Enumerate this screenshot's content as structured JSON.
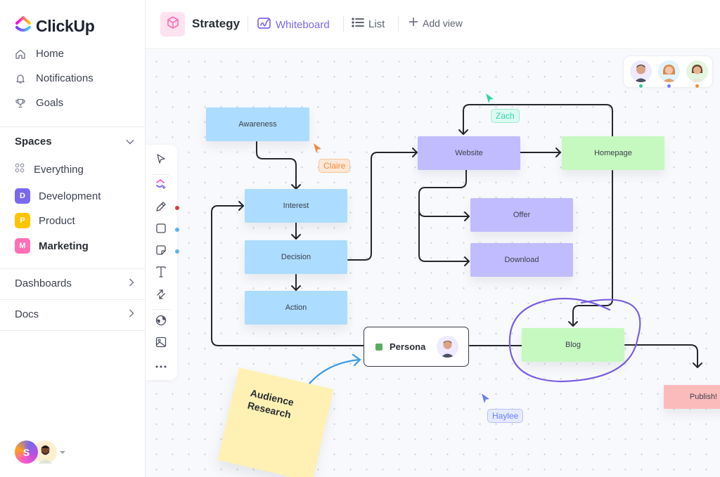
{
  "sidebar": {
    "brand": "ClickUp",
    "nav": [
      {
        "label": "Home",
        "icon": "home-icon"
      },
      {
        "label": "Notifications",
        "icon": "bell-icon"
      },
      {
        "label": "Goals",
        "icon": "trophy-icon"
      }
    ],
    "spaces_label": "Spaces",
    "everything_label": "Everything",
    "spaces": [
      {
        "letter": "D",
        "label": "Development",
        "color": "#7b68ee"
      },
      {
        "letter": "P",
        "label": "Product",
        "color": "#ffc400"
      },
      {
        "letter": "M",
        "label": "Marketing",
        "color": "#ff6fb6",
        "active": true
      }
    ],
    "dashboards_label": "Dashboards",
    "docs_label": "Docs",
    "user_initial": "S"
  },
  "header": {
    "project_title": "Strategy",
    "views": [
      {
        "label": "Whiteboard",
        "active": true
      },
      {
        "label": "List",
        "active": false
      }
    ],
    "add_view_label": "Add view"
  },
  "canvas": {
    "collaborators": [
      {
        "name": "collaborator-1",
        "status_color": "#22d39b",
        "bg": "#efeaff"
      },
      {
        "name": "collaborator-2",
        "status_color": "#6a7cff",
        "bg": "#e2f3fb"
      },
      {
        "name": "collaborator-3",
        "status_color": "#f08a2c",
        "bg": "#e4f5e0"
      }
    ],
    "nodes": {
      "awareness": "Awareness",
      "interest": "Interest",
      "decision": "Decision",
      "action": "Action",
      "website": "Website",
      "homepage": "Homepage",
      "offer": "Offer",
      "download": "Download",
      "blog": "Blog",
      "publish": "Publish!"
    },
    "persona_label": "Persona",
    "sticky_note": "Audience Research",
    "cursors": [
      {
        "name": "Claire",
        "color": "#f08a3c"
      },
      {
        "name": "Zach",
        "color": "#2fd6a3"
      },
      {
        "name": "Haylee",
        "color": "#6a7cff"
      }
    ],
    "colors": {
      "accent": "#7b68ee",
      "node_blue": "#acdcff",
      "node_purple": "#c1bcff",
      "node_green": "#c6f9c0",
      "node_pink": "#fcbbbb",
      "sticky": "#fff1b3"
    }
  }
}
